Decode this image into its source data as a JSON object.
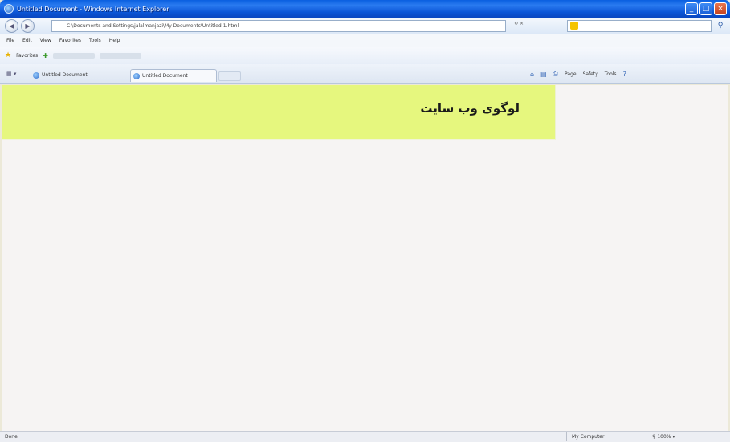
{
  "window": {
    "title": "Untitled Document - Windows Internet Explorer",
    "buttons": {
      "minimize": "_",
      "maximize": "□",
      "close": "×"
    }
  },
  "addressbar": {
    "back_icon": "back-arrow-icon",
    "forward_icon": "forward-arrow-icon",
    "url": "C:\\Documents and Settings\\jalalmanjazi\\My Documents\\Untitled-1.html",
    "search_placeholder": "",
    "refresh": "↻",
    "stop": "×",
    "go_label": "⚲"
  },
  "menubar": {
    "items": [
      "File",
      "Edit",
      "View",
      "Favorites",
      "Tools",
      "Help"
    ]
  },
  "favorites_bar": {
    "favorites_label": "Favorites"
  },
  "tabs": {
    "items": [
      {
        "label": "Untitled Document",
        "active": false
      },
      {
        "label": "Untitled Document",
        "active": true
      }
    ],
    "command_bar": [
      "Page",
      "Safety",
      "Tools"
    ]
  },
  "content": {
    "logo_text": "لوگوی وب سایت",
    "header_color": "#e6f77e",
    "background_color": "#f6f4f3"
  },
  "statusbar": {
    "status": "Done",
    "zone": "My Computer",
    "zoom": "100%"
  }
}
